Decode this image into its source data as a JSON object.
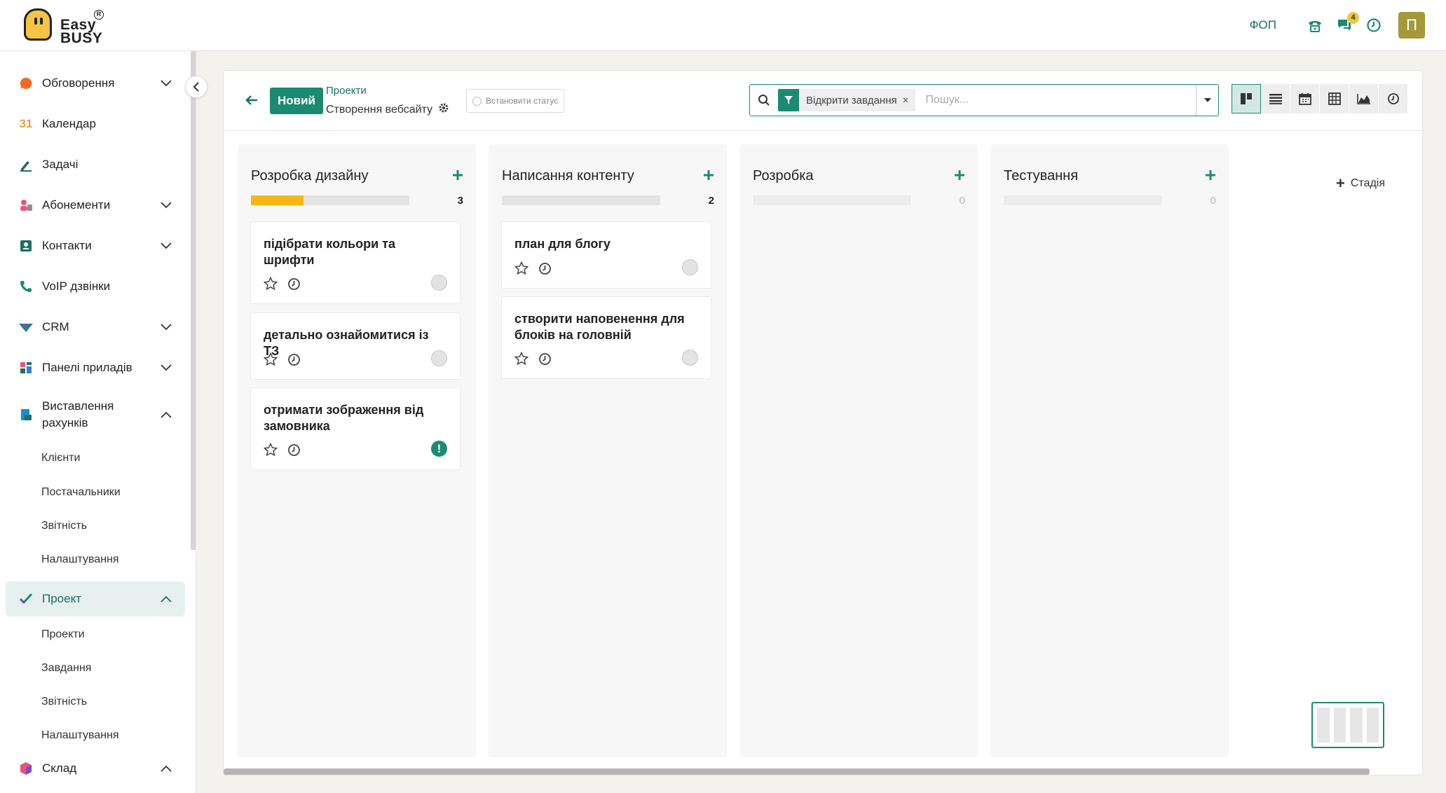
{
  "topbar": {
    "logo_text_1": "Easy",
    "logo_text_2": "BUSY",
    "company": "ФОП",
    "chat_badge": "4",
    "avatar_letter": "П"
  },
  "sidebar": {
    "items": [
      {
        "label": "Обговорення",
        "icon": "discuss-icon"
      },
      {
        "label": "Календар",
        "icon": "calendar-icon",
        "icon_text": "31"
      },
      {
        "label": "Задачі",
        "icon": "pencil-icon"
      },
      {
        "label": "Абонементи",
        "icon": "subscriptions-icon"
      },
      {
        "label": "Контакти",
        "icon": "contacts-icon"
      },
      {
        "label": "VoIP дзвінки",
        "icon": "phone-icon"
      },
      {
        "label": "CRM",
        "icon": "crm-icon"
      },
      {
        "label": "Панелі приладів",
        "icon": "dashboard-icon"
      },
      {
        "label": "Виставлення рахунків",
        "icon": "invoice-icon"
      },
      {
        "label": "Проект",
        "icon": "checkmark-icon"
      },
      {
        "label": "Склад",
        "icon": "inventory-icon"
      }
    ],
    "invoicing_sub": [
      "Клієнти",
      "Постачальники",
      "Звітність",
      "Налаштування"
    ],
    "project_sub": [
      "Проекти",
      "Завдання",
      "Звітність",
      "Налаштування"
    ]
  },
  "control": {
    "new_label": "Новий",
    "breadcrumb_parent": "Проекти",
    "breadcrumb_current": "Створення вебсайту",
    "status_label": "Встановити статус",
    "filter_label": "Відкрити завдання",
    "filter_remove": "×",
    "search_placeholder": "Пошук..."
  },
  "kanban": {
    "columns": [
      {
        "title": "Розробка дизайну",
        "count": "3",
        "progress": 0.33,
        "cards": [
          {
            "title": "підібрати кольори та шрифти",
            "priority": "normal"
          },
          {
            "title": "детально ознайомитися із ТЗ",
            "priority": "normal"
          },
          {
            "title": "отримати зображення від замовника",
            "priority": "high"
          }
        ]
      },
      {
        "title": "Написання контенту",
        "count": "2",
        "progress": 0,
        "cards": [
          {
            "title": "план для блогу",
            "priority": "normal"
          },
          {
            "title": "створити наповенення для блоків на головній",
            "priority": "normal"
          }
        ]
      },
      {
        "title": "Розробка",
        "count": "0",
        "progress": 0,
        "cards": []
      },
      {
        "title": "Тестування",
        "count": "0",
        "progress": 0,
        "cards": []
      }
    ],
    "add_stage": "Стадія"
  },
  "colors": {
    "accent": "#1b8a72",
    "progress": "#f6b715",
    "badge": "#f2c63d",
    "avatar": "#a3993a"
  }
}
